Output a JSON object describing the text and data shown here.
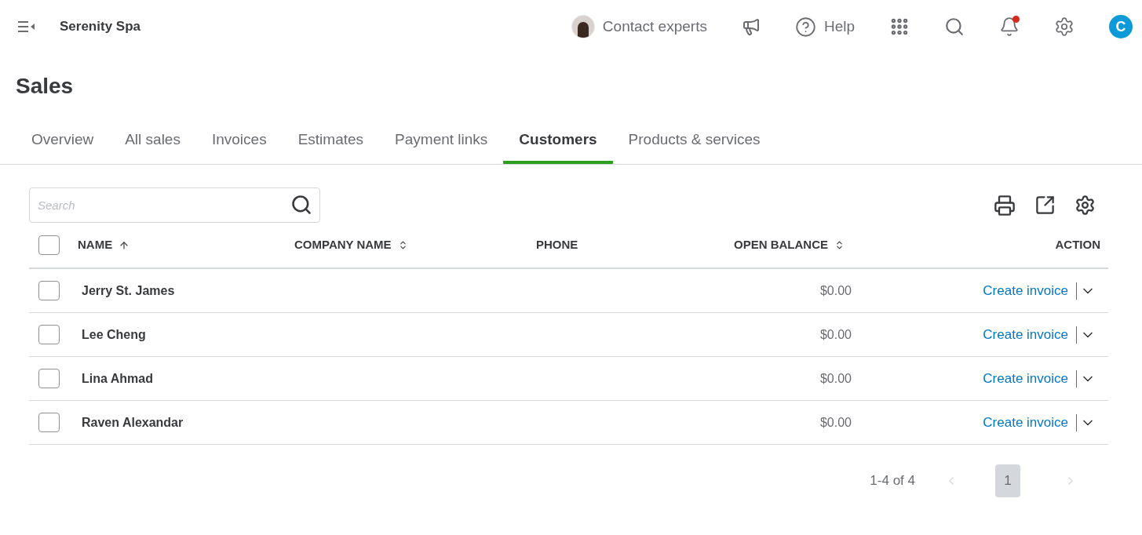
{
  "topbar": {
    "company": "Serenity Spa",
    "contact": "Contact experts",
    "help": "Help",
    "avatar": "C",
    "notifications_unread": true
  },
  "page": {
    "title": "Sales"
  },
  "tabs": [
    {
      "label": "Overview",
      "selected": false
    },
    {
      "label": "All sales",
      "selected": false
    },
    {
      "label": "Invoices",
      "selected": false
    },
    {
      "label": "Estimates",
      "selected": false
    },
    {
      "label": "Payment links",
      "selected": false
    },
    {
      "label": "Customers",
      "selected": true
    },
    {
      "label": "Products & services",
      "selected": false
    }
  ],
  "search": {
    "placeholder": "Search"
  },
  "table": {
    "select_all_checked": false,
    "columns": [
      {
        "label": "NAME",
        "sortable": true,
        "sorted_ascending": true
      },
      {
        "label": "COMPANY NAME",
        "sortable": true,
        "sorted_ascending": false
      },
      {
        "label": "PHONE",
        "sortable": false
      },
      {
        "label": "OPEN BALANCE",
        "sortable": true,
        "sorted_ascending": false
      },
      {
        "label": "ACTION",
        "sortable": false
      }
    ],
    "rows": [
      {
        "checked": false,
        "name": "Jerry St. James",
        "open_balance": "$0.00",
        "action": "Create invoice"
      },
      {
        "checked": false,
        "name": "Lee Cheng",
        "open_balance": "$0.00",
        "action": "Create invoice"
      },
      {
        "checked": false,
        "name": "Lina Ahmad",
        "open_balance": "$0.00",
        "action": "Create invoice"
      },
      {
        "checked": false,
        "name": "Raven Alexandar",
        "open_balance": "$0.00",
        "action": "Create invoice"
      }
    ]
  },
  "pagination": {
    "range": "1-4 of 4",
    "previous_disabled": true,
    "next_disabled": true,
    "pages": [
      {
        "label": "1",
        "selected": true
      }
    ]
  }
}
